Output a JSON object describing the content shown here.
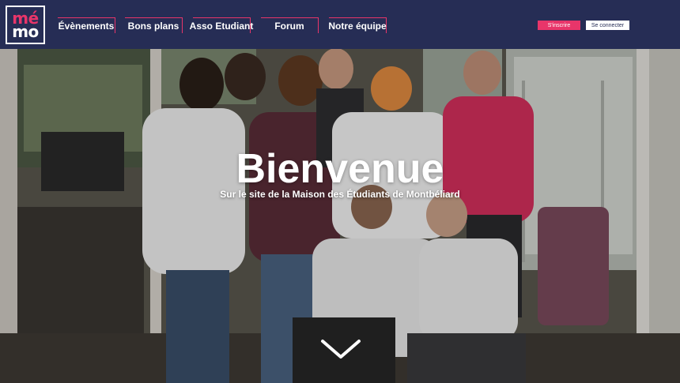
{
  "brand": {
    "logo_line1": "mé",
    "logo_line2": "mo",
    "accent_color": "#e8356a",
    "navbar_color": "#262d55"
  },
  "nav": {
    "items": [
      {
        "label": "Évènements"
      },
      {
        "label": "Bons plans"
      },
      {
        "label": "Asso Etudiant"
      },
      {
        "label": "Forum"
      },
      {
        "label": "Notre équipe"
      }
    ]
  },
  "auth": {
    "signup_label": "S'inscrire",
    "login_label": "Se connecter"
  },
  "hero": {
    "title": "Bienvenue",
    "subtitle": "Sur le site de la Maison des Étudiants de Montbéliard",
    "scroll_icon": "chevron-down-icon"
  }
}
